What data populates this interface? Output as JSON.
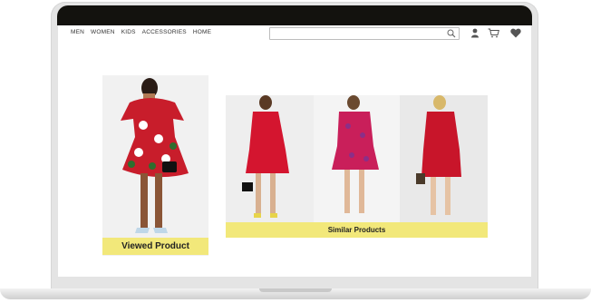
{
  "nav": {
    "items": [
      "MEN",
      "WOMEN",
      "KIDS",
      "ACCESSORIES",
      "HOME"
    ]
  },
  "search": {
    "value": "",
    "placeholder": ""
  },
  "icons": {
    "search": "search-icon",
    "user": "user-icon",
    "cart": "cart-icon",
    "wishlist": "heart-icon"
  },
  "viewed": {
    "label": "Viewed Product"
  },
  "similar": {
    "label": "Similar Products"
  },
  "colors": {
    "highlight": "#f2e87a",
    "bezel": "#13120e",
    "dress_red": "#d4152f"
  }
}
